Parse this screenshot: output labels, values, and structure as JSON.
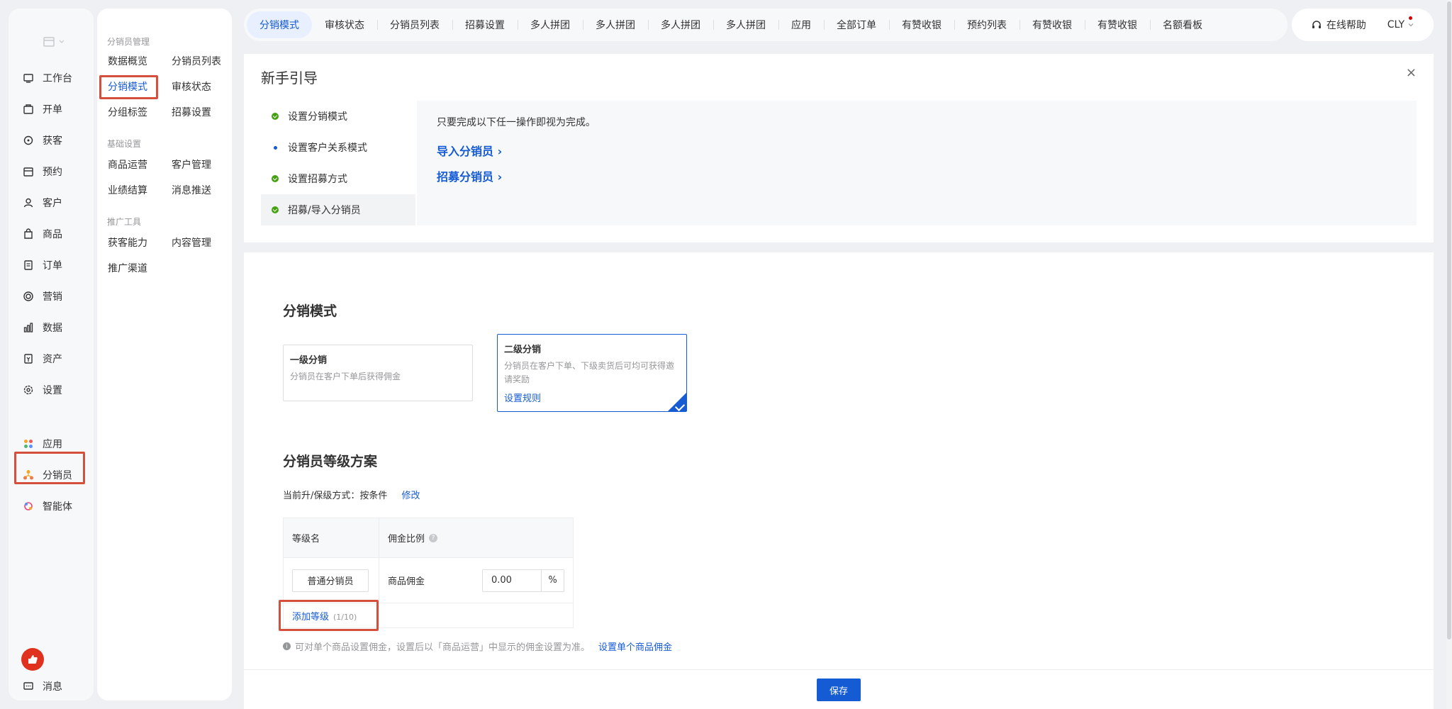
{
  "sidebar": {
    "items": [
      {
        "label": "工作台",
        "icon": "workbench-icon"
      },
      {
        "label": "开单",
        "icon": "billing-icon"
      },
      {
        "label": "获客",
        "icon": "acquire-icon"
      },
      {
        "label": "预约",
        "icon": "calendar-icon"
      },
      {
        "label": "客户",
        "icon": "user-icon"
      },
      {
        "label": "商品",
        "icon": "bag-icon"
      },
      {
        "label": "订单",
        "icon": "order-icon"
      },
      {
        "label": "营销",
        "icon": "target-icon"
      },
      {
        "label": "数据",
        "icon": "bar-chart-icon"
      },
      {
        "label": "资产",
        "icon": "asset-icon"
      },
      {
        "label": "设置",
        "icon": "gear-icon"
      }
    ],
    "bottom_items": [
      {
        "label": "应用",
        "icon": "apps-icon"
      },
      {
        "label": "分销员",
        "icon": "distributor-icon"
      },
      {
        "label": "智能体",
        "icon": "agent-icon"
      }
    ],
    "message_label": "消息"
  },
  "subnav": {
    "groups": [
      {
        "title": "分销员管理",
        "links": [
          "数据概览",
          "分销员列表",
          "分销模式",
          "审核状态",
          "分组标签",
          "招募设置"
        ]
      },
      {
        "title": "基础设置",
        "links": [
          "商品运营",
          "客户管理",
          "业绩结算",
          "消息推送"
        ]
      },
      {
        "title": "推广工具",
        "links": [
          "获客能力",
          "内容管理",
          "推广渠道"
        ]
      }
    ]
  },
  "tabs": [
    "分销模式",
    "审核状态",
    "分销员列表",
    "招募设置",
    "多人拼团",
    "多人拼团",
    "多人拼团",
    "多人拼团",
    "应用",
    "全部订单",
    "有赞收银",
    "预约列表",
    "有赞收银",
    "有赞收银",
    "名额看板"
  ],
  "topright": {
    "help": "在线帮助",
    "user": "CLY"
  },
  "guide": {
    "title": "新手引导",
    "close": "×",
    "steps": [
      "设置分销模式",
      "设置客户关系模式",
      "设置招募方式",
      "招募/导入分销员"
    ],
    "hint": "只要完成以下任一操作即视为完成。",
    "links": [
      "导入分销员 ›",
      "招募分销员 ›"
    ]
  },
  "mode": {
    "title": "分销模式",
    "cards": [
      {
        "title": "一级分销",
        "desc": "分销员在客户下单后获得佣金"
      },
      {
        "title": "二级分销",
        "desc": "分销员在客户下单、下级卖货后可均可获得邀请奖励",
        "rule": "设置规则"
      }
    ]
  },
  "levels": {
    "title": "分销员等级方案",
    "upgrade_label": "当前升/保级方式：按条件",
    "modify": "修改",
    "head_name": "等级名",
    "head_ratio": "佣金比例",
    "help_q": "?",
    "row_name": "普通分销员",
    "row_type": "商品佣金",
    "row_value": "0.00",
    "unit": "%",
    "add": "添加等级",
    "add_count": "(1/10)",
    "info": "i",
    "note": "可对单个商品设置佣金，设置后以「商品运营」中显示的佣金设置为准。",
    "note_link": "设置单个商品佣金"
  },
  "footer": {
    "save": "保存"
  }
}
